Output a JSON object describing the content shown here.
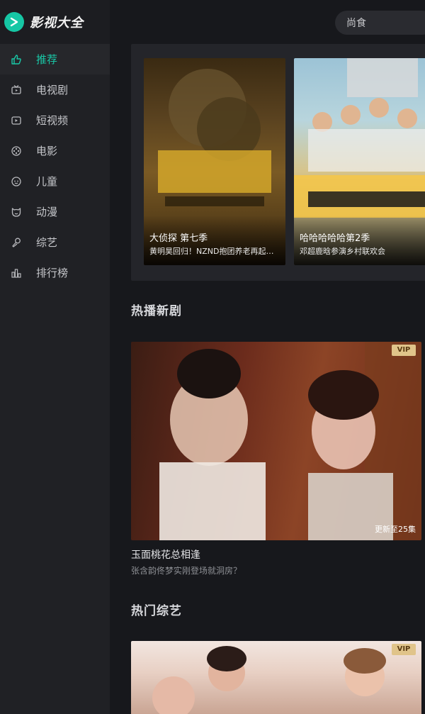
{
  "brand": {
    "title": "影视大全",
    "accent": "#19c8a7"
  },
  "nav": [
    {
      "label": "推荐",
      "icon": "thumb-up-icon",
      "active": true
    },
    {
      "label": "电视剧",
      "icon": "tv-icon"
    },
    {
      "label": "短视频",
      "icon": "short-video-icon"
    },
    {
      "label": "电影",
      "icon": "film-reel-icon"
    },
    {
      "label": "儿童",
      "icon": "child-face-icon"
    },
    {
      "label": "动漫",
      "icon": "anime-face-icon"
    },
    {
      "label": "综艺",
      "icon": "microphone-icon"
    },
    {
      "label": "排行榜",
      "icon": "bar-chart-icon"
    }
  ],
  "search": {
    "value": "尚食"
  },
  "featured": [
    {
      "title": "大侦探 第七季",
      "subtitle": "黄明昊回归！NZND抱团养老再起…"
    },
    {
      "title": "哈哈哈哈哈第2季",
      "subtitle": "邓超鹿晗参演乡村联欢会"
    }
  ],
  "hot_drama": {
    "section_title": "热播新剧",
    "badge": "VIP",
    "update": "更新至25集",
    "name": "玉面桃花总相逢",
    "desc": "张含韵佟梦实刚登场就洞房？"
  },
  "hot_variety": {
    "section_title": "热门综艺",
    "badge": "VIP"
  }
}
